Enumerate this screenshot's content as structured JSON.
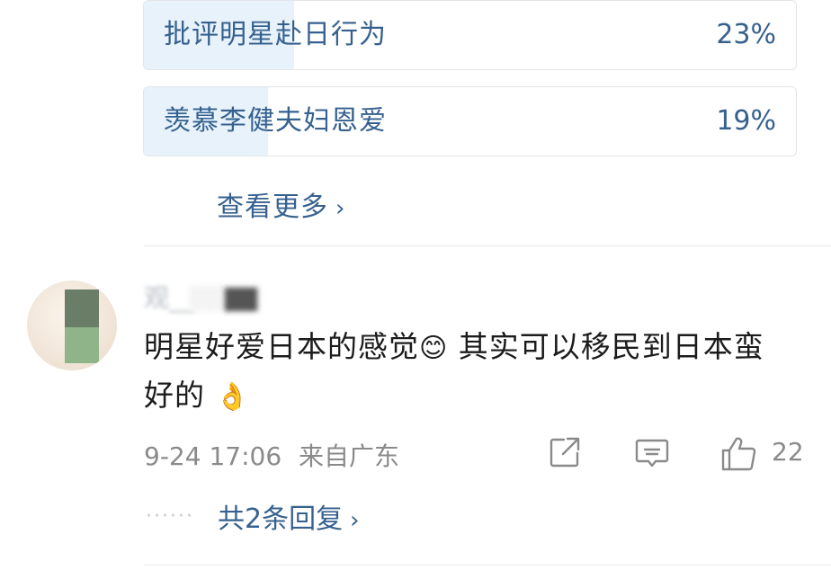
{
  "poll": {
    "options": [
      {
        "label": "批评明星赴日行为",
        "percent_label": "23%",
        "percent": 23
      },
      {
        "label": "羡慕李健夫妇恩爱",
        "percent_label": "19%",
        "percent": 19
      }
    ],
    "see_more": "查看更多",
    "see_more_chevron": "›",
    "colors": {
      "accent": "#36618f",
      "fill": "#e8f2fb"
    }
  },
  "comment": {
    "username": "观__ vip",
    "text_part1": "明星好爱日本的感觉",
    "emoji1": "😊",
    "text_part2": " 其实可以移民到日本蛮好的 ",
    "emoji2": "👌",
    "timestamp": "9-24 17:06",
    "location": "来自广东",
    "like_count": "22",
    "replies_label": "共2条回复",
    "replies_dots": "······",
    "replies_chevron": "›",
    "icons": [
      "avatar",
      "share-icon",
      "comment-icon",
      "like-icon"
    ]
  }
}
